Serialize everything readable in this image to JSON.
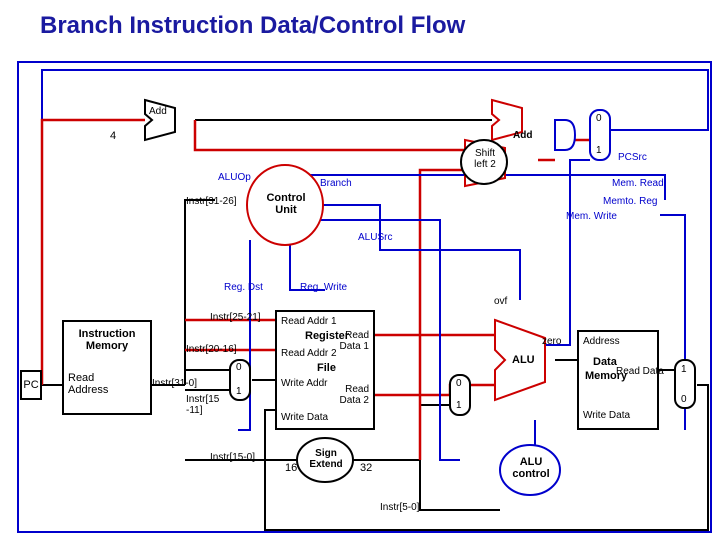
{
  "title": "Branch Instruction Data/Control Flow",
  "blocks": {
    "pc": "PC",
    "instr_mem_l1": "Instruction",
    "instr_mem_l2": "Memory",
    "read_addr": "Read",
    "read_addr2": "Address",
    "add1": "Add",
    "add2": "Add",
    "const4": "4",
    "shift_left": "Shift",
    "shift_left2": "left 2",
    "control_unit_l1": "Control",
    "control_unit_l2": "Unit",
    "regfile_l1": "Register",
    "regfile_l2": "File",
    "read_addr1_port": "Read Addr 1",
    "read_addr2_port": "Read Addr 2",
    "write_addr_port": "Write Addr",
    "write_data_port": "Write Data",
    "read_data1_port": "Read",
    "read_data1_port2": "Data 1",
    "read_data2_port": "Read",
    "read_data2_port2": "Data 2",
    "sign_ext_l1": "Sign",
    "sign_ext_l2": "Extend",
    "alu": "ALU",
    "alu_control_l1": "ALU",
    "alu_control_l2": "control",
    "data_mem_l1": "Data",
    "data_mem_l2": "Memory",
    "dm_address": "Address",
    "dm_read_data": "Read Data",
    "dm_write_data": "Write Data",
    "ovf": "ovf",
    "zero": "zero"
  },
  "mux_labels": {
    "zero": "0",
    "one": "1"
  },
  "bit_widths": {
    "sixteen": "16",
    "thirtytwo": "32"
  },
  "instr_fields": {
    "f31_0": "Instr[31-0]",
    "f31_26": "Instr[31-26]",
    "f25_21": "Instr[25-21]",
    "f20_16": "Instr[20-16]",
    "f15_11_l1": "Instr[15",
    "f15_11_l2": "-11]",
    "f15_0": "Instr[15-0]",
    "f5_0": "Instr[5-0]"
  },
  "control_signals": {
    "aluop": "ALUOp",
    "branch": "Branch",
    "memread": "Mem. Read",
    "memtoreg": "Memto. Reg",
    "memwrite": "Mem. Write",
    "pcsrc": "PCSrc",
    "alusrc": "ALUSrc",
    "regdst": "Reg. Dst",
    "regwrite": "Reg. Write"
  }
}
